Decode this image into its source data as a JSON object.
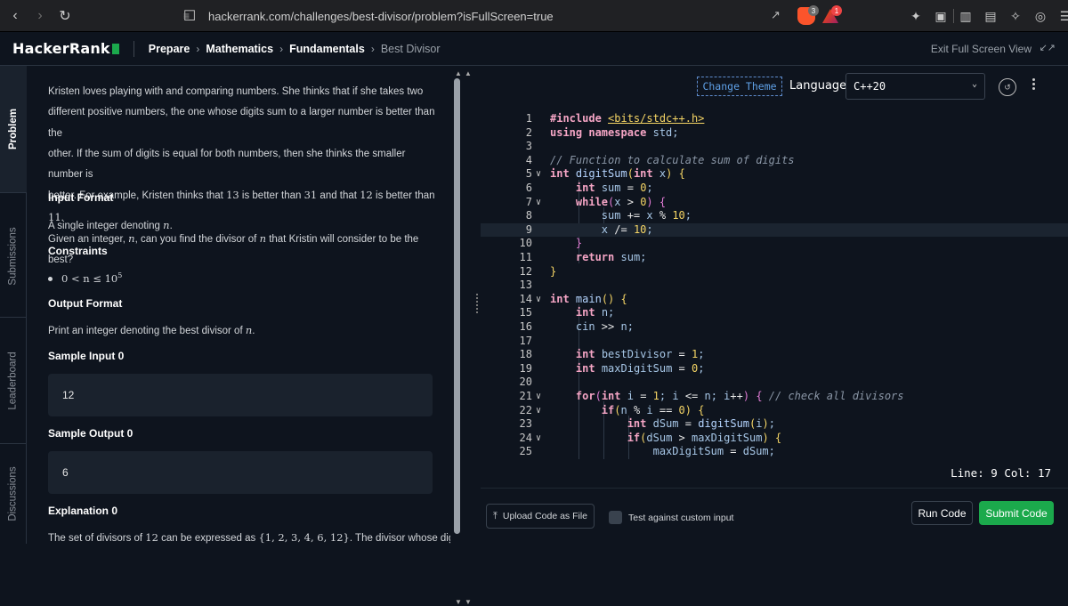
{
  "browser": {
    "url": "hackerrank.com/challenges/best-divisor/problem?isFullScreen=true",
    "badge_brave": "3",
    "badge_rewards": "1"
  },
  "header": {
    "logo": "HackerRank",
    "breadcrumbs": [
      "Prepare",
      "Mathematics",
      "Fundamentals",
      "Best Divisor"
    ],
    "exit_fullscreen": "Exit Full Screen View"
  },
  "sidetabs": [
    "Problem",
    "Submissions",
    "Leaderboard",
    "Discussions"
  ],
  "problem": {
    "intro_lines": [
      "Kristen loves playing with and comparing numbers. She thinks that if she takes two",
      "different positive numbers, the one whose digits sum to a larger number is better than the",
      "other. If the sum of digits is equal for both numbers, then she thinks the smaller number is"
    ],
    "line4_a": "better. For example, Kristen thinks that ",
    "line4_n1": "13",
    "line4_b": " is better than ",
    "line4_n2": "31",
    "line4_c": " and that ",
    "line4_n3": "12",
    "line4_d": " is better than ",
    "line4_n4": "11",
    "line4_e": ".",
    "line5_a": "Given an integer, ",
    "line5_var1": "n",
    "line5_b": ", can you find the divisor of ",
    "line5_var2": "n",
    "line5_c": " that Kristin will consider to be the best?",
    "input_format_heading": "Input Format",
    "input_format_text_a": "A single integer denoting ",
    "input_format_var": "n",
    "input_format_text_b": ".",
    "constraints_heading": "Constraints",
    "constraint": "0 < n ≤ 10",
    "constraint_exp": "5",
    "output_format_heading": "Output Format",
    "output_format_text_a": "Print an integer denoting the best divisor of ",
    "output_format_var": "n",
    "output_format_text_b": ".",
    "sample_input_heading": "Sample Input 0",
    "sample_input": "12",
    "sample_output_heading": "Sample Output 0",
    "sample_output": "6",
    "explanation_heading": "Explanation 0",
    "explanation_a": "The set of divisors of ",
    "explanation_n": "12",
    "explanation_b": " can be expressed as ",
    "explanation_set": "{1, 2, 3, 4, 6, 12}",
    "explanation_c": ". The divisor whose digits"
  },
  "editor": {
    "change_theme": "Change Theme",
    "language_label": "Language",
    "language_value": "C++20",
    "status": "Line: 9 Col: 17",
    "code_lines": [
      "#include <bits/stdc++.h>",
      "using namespace std;",
      "",
      "// Function to calculate sum of digits",
      "int digitSum(int x) {",
      "    int sum = 0;",
      "    while(x > 0) {",
      "        sum += x % 10;",
      "        x /= 10;",
      "    }",
      "    return sum;",
      "}",
      "",
      "int main() {",
      "    int n;",
      "    cin >> n;",
      "",
      "    int bestDivisor = 1;",
      "    int maxDigitSum = 0;",
      "",
      "    for(int i = 1; i <= n; i++) { // check all divisors",
      "        if(n % i == 0) {",
      "            int dSum = digitSum(i);",
      "            if(dSum > maxDigitSum) {",
      "                maxDigitSum = dSum;"
    ],
    "line_numbers": [
      "1",
      "2",
      "3",
      "4",
      "5",
      "6",
      "7",
      "8",
      "9",
      "10",
      "11",
      "12",
      "13",
      "14",
      "15",
      "16",
      "17",
      "18",
      "19",
      "20",
      "21",
      "22",
      "23",
      "24",
      "25"
    ]
  },
  "footer": {
    "upload": "Upload Code as File",
    "test_custom": "Test against custom input",
    "run": "Run Code",
    "submit": "Submit Code"
  },
  "colors": {
    "accent_green": "#1ba94c",
    "background": "#0e141e"
  }
}
